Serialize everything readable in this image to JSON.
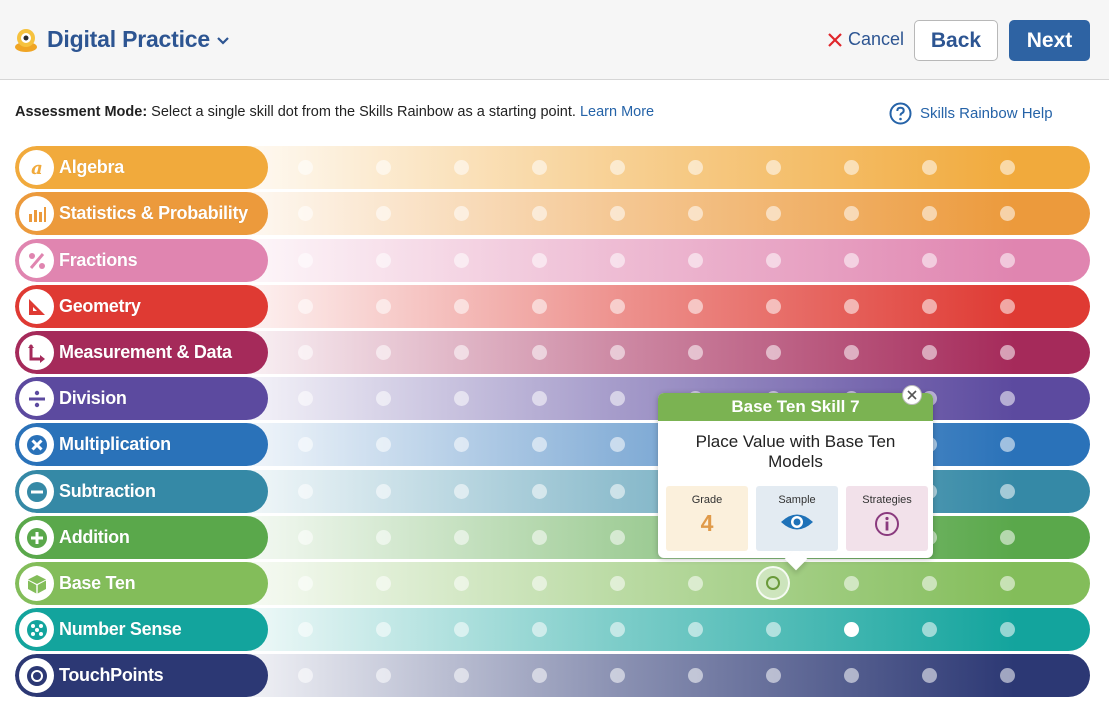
{
  "header": {
    "app_title": "Digital Practice",
    "cancel_label": "Cancel",
    "back_label": "Back",
    "next_label": "Next"
  },
  "instruction": {
    "mode_label": "Assessment Mode:",
    "text": " Select a single skill dot from the Skills Rainbow as a starting point. ",
    "learn_more": "Learn More",
    "help_label": "Skills Rainbow Help"
  },
  "rows": [
    {
      "label": "Algebra",
      "icon": "algebra-icon",
      "color": "#f1aa3c"
    },
    {
      "label": "Statistics & Probability",
      "icon": "bar-chart-icon",
      "color": "#ec9a3c"
    },
    {
      "label": "Fractions",
      "icon": "percent-icon",
      "color": "#e085b0"
    },
    {
      "label": "Geometry",
      "icon": "triangle-ruler-icon",
      "color": "#df3a33"
    },
    {
      "label": "Measurement & Data",
      "icon": "measure-arrow-icon",
      "color": "#a52a5a"
    },
    {
      "label": "Division",
      "icon": "divide-icon",
      "color": "#5c4a9f"
    },
    {
      "label": "Multiplication",
      "icon": "multiply-icon",
      "color": "#2a72b9"
    },
    {
      "label": "Subtraction",
      "icon": "minus-icon",
      "color": "#3589a6"
    },
    {
      "label": "Addition",
      "icon": "plus-icon",
      "color": "#5aa84b"
    },
    {
      "label": "Base Ten",
      "icon": "cube-icon",
      "color": "#83bd5a"
    },
    {
      "label": "Number Sense",
      "icon": "dots-icon",
      "color": "#13a49d"
    },
    {
      "label": "TouchPoints",
      "icon": "target-icon",
      "color": "#2c3874"
    }
  ],
  "popup": {
    "title": "Base Ten Skill 7",
    "description": "Place Value with Base Ten Models",
    "grade_label": "Grade",
    "grade_value": "4",
    "sample_label": "Sample",
    "strategies_label": "Strategies"
  }
}
